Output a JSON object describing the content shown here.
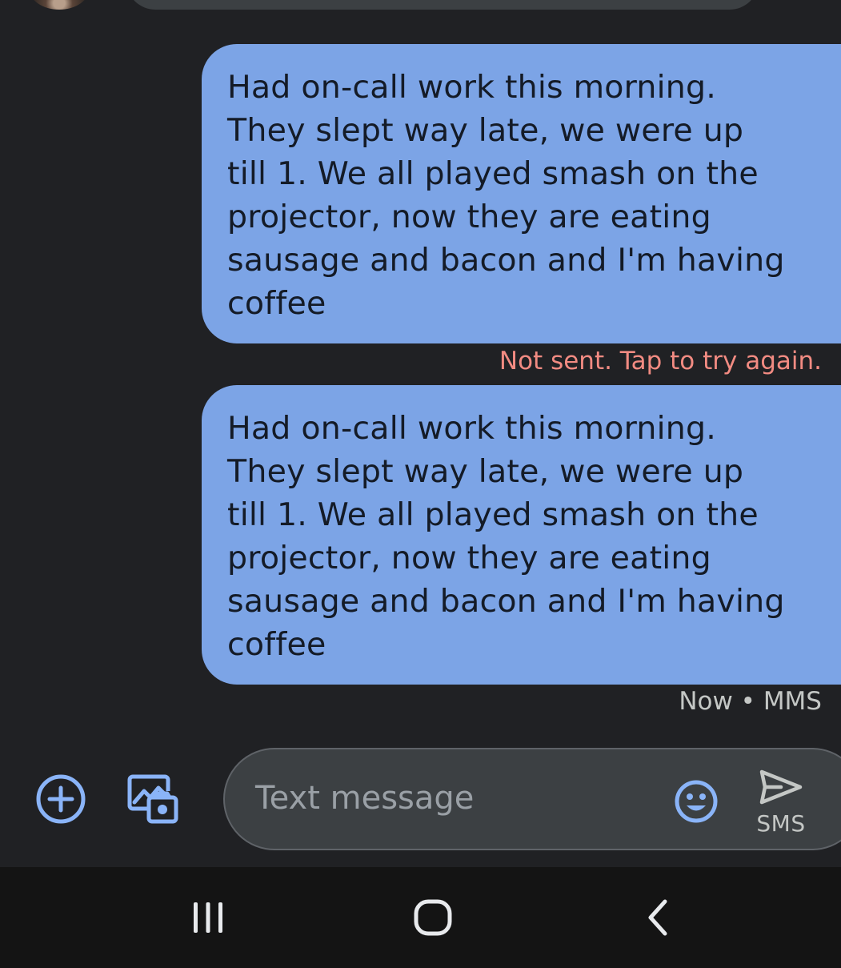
{
  "conversation": {
    "messages": [
      {
        "lines": [
          "Had on-call work this morning.",
          "They slept way late, we were up",
          "till 1. We all played smash on the",
          "projector, now they are eating",
          "sausage and bacon and I'm having",
          "coffee"
        ],
        "status": "Not sent. Tap to try again."
      },
      {
        "lines": [
          "Had on-call work this morning.",
          "They slept way late, we were up",
          "till 1. We all played smash on the",
          "projector, now they are eating",
          "sausage and bacon and I'm having",
          "coffee"
        ],
        "status": "Now • MMS"
      }
    ]
  },
  "compose": {
    "placeholder": "Text message",
    "send_label": "SMS",
    "icons": {
      "attach": "plus-circle-icon",
      "gallery": "gallery-camera-icon",
      "emoji": "smiley-icon",
      "send": "send-arrow-icon"
    }
  },
  "navbar": {
    "icons": [
      "recent-apps-icon",
      "home-icon",
      "back-icon"
    ]
  },
  "colors": {
    "background": "#202124",
    "outgoing_bubble": "#7ca4e6",
    "bubble_text": "#141b27",
    "error_text": "#f28b82",
    "meta_text": "#c4c7c5",
    "accent_icon": "#8ab4f8",
    "compose_field": "#3c4043",
    "navbar": "#141414"
  }
}
